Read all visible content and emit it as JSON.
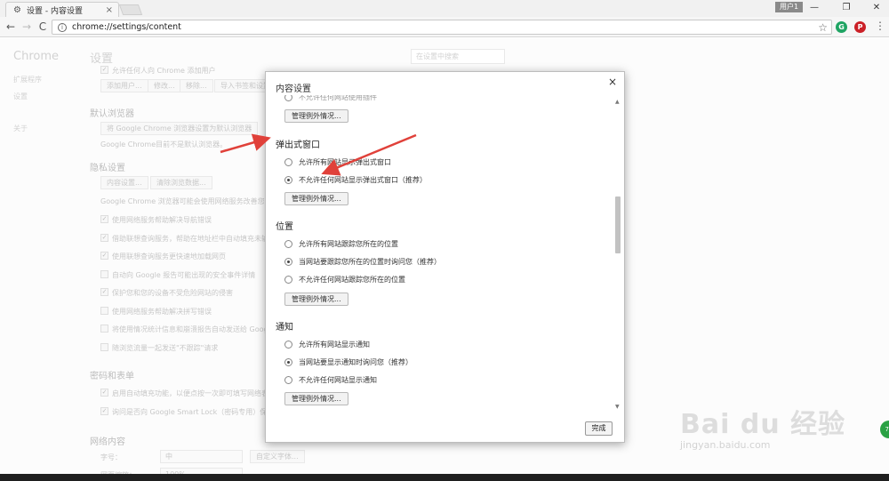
{
  "window": {
    "tab_title": "设置 - 内容设置",
    "tab_close": "×",
    "user_label": "用户1",
    "min": "—",
    "restore": "❐",
    "close": "✕"
  },
  "toolbar": {
    "back": "←",
    "forward": "→",
    "reload": "C",
    "url": "chrome://settings/content",
    "info": "i",
    "star": "☆",
    "menu": "⋮",
    "ext1": "G",
    "ext2": "P"
  },
  "background": {
    "sidebar_title": "Chrome",
    "sidebar_items": [
      "扩展程序",
      "设置",
      "关于"
    ],
    "content_title": "设置",
    "search_placeholder": "在设置中搜索",
    "user_text": "允许任何人向 Chrome 添加用户",
    "user_buttons": [
      "添加用户...",
      "修改...",
      "移除...",
      "导入书签和设置..."
    ],
    "default_browser_heading": "默认浏览器",
    "default_browser_button": "将 Google Chrome 浏览器设置为默认浏览器",
    "default_browser_note": "Google Chrome目前不是默认浏览器。",
    "privacy_heading": "隐私设置",
    "privacy_buttons": [
      "内容设置...",
      "清除浏览数据..."
    ],
    "privacy_note": "Google Chrome 浏览器可能会使用网络服务改善您的浏览体验",
    "privacy_options": [
      "使用网络服务帮助解决导航错误",
      "借助联想查询服务，帮助在地址栏中自动填充未输入",
      "使用联想查询服务更快速地加载网页",
      "自动向 Google 报告可能出现的安全事件详情",
      "保护您和您的设备不受危险网站的侵害",
      "使用网络服务帮助解决拼写错误",
      "将使用情况统计信息和崩溃报告自动发送给 Google",
      "随浏览流量一起发送\"不跟踪\"请求"
    ],
    "privacy_checked": [
      true,
      true,
      true,
      false,
      true,
      false,
      false,
      false
    ],
    "password_heading": "密码和表单",
    "password_options": [
      "启用自动填充功能，以便点按一次即可填写网络表单",
      "询问是否向 Google Smart Lock（密码专用）保存您的密码"
    ],
    "web_content_heading": "网络内容",
    "font_size_label": "字号：",
    "font_size_value": "中",
    "custom_font_button": "自定义字体...",
    "zoom_label": "网页缩放：",
    "zoom_value": "100%"
  },
  "dialog": {
    "title": "内容设置",
    "close": "×",
    "top_cut_option": "不允许任何网站使用插件",
    "manage_label": "管理例外情况...",
    "popups": {
      "title": "弹出式窗口",
      "options": [
        "允许所有网站显示弹出式窗口",
        "不允许任何网站显示弹出式窗口（推荐）"
      ],
      "selected": 1
    },
    "location": {
      "title": "位置",
      "options": [
        "允许所有网站跟踪您所在的位置",
        "当网站要跟踪您所在的位置时询问您（推荐）",
        "不允许任何网站跟踪您所在的位置"
      ],
      "selected": 1
    },
    "notifications": {
      "title": "通知",
      "options": [
        "允许所有网站显示通知",
        "当网站要显示通知时询问您（推荐）",
        "不允许任何网站显示通知"
      ],
      "selected": 1
    },
    "done_label": "完成"
  },
  "watermark": {
    "main": "Bai du 经验",
    "sub": "jingyan.baidu.com"
  },
  "colors": {
    "annotation_arrow": "#e0413a",
    "green_badge": "#2ba245",
    "ext1": "#1fa463",
    "ext2": "#cb2027"
  }
}
